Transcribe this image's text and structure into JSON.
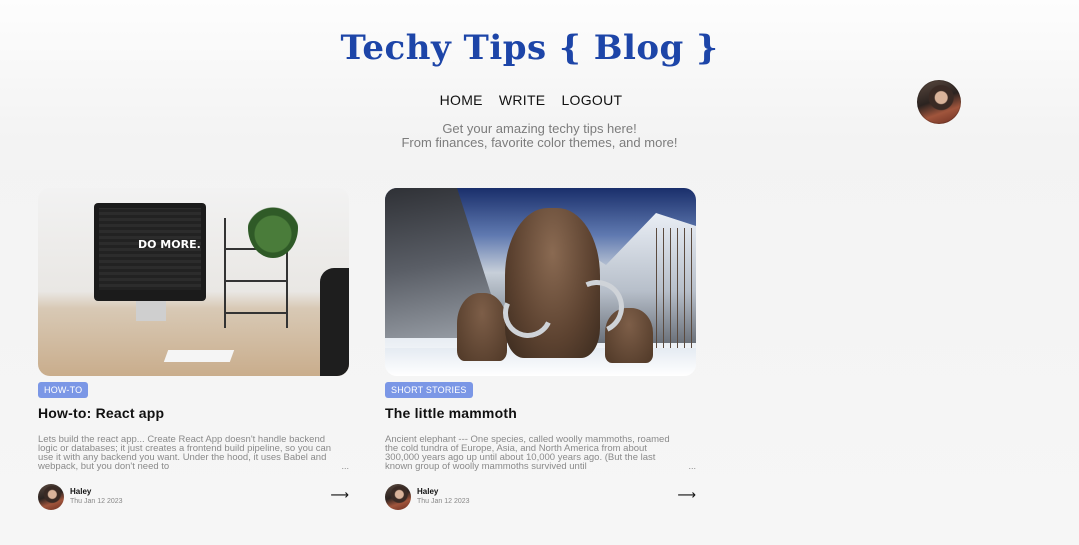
{
  "header": {
    "blog_title": "Techy Tips { Blog }",
    "nav": [
      "HOME",
      "WRITE",
      "LOGOUT"
    ],
    "tagline_line1": "Get your amazing techy tips here!",
    "tagline_line2": "From finances, favorite color themes, and more!"
  },
  "posts": [
    {
      "category": "HOW-TO",
      "title": "How-to: React app",
      "excerpt": "Lets build the react app... Create React App doesn't handle backend logic or databases; it just creates a frontend build pipeline, so you can use it with any backend you want. Under the hood, it uses Babel and webpack, but you don't need to",
      "ellipsis": "...",
      "author": "Haley",
      "date": "Thu Jan 12 2023",
      "monitor_text": "DO MORE."
    },
    {
      "category": "SHORT STORIES",
      "title": "The little mammoth",
      "excerpt": "Ancient elephant --- One species, called woolly mammoths, roamed the cold tundra of Europe, Asia, and North America from about 300,000 years ago up until about 10,000 years ago. (But the last known group of woolly mammoths survived until",
      "ellipsis": "...",
      "author": "Haley",
      "date": "Thu Jan 12 2023"
    }
  ],
  "icons": {
    "read_more": "right-arrow-icon",
    "profile": "user-avatar"
  },
  "colors": {
    "title_blue": "#1d45a8",
    "tag_blue": "#7b97e6",
    "background": "#f6f6f6"
  }
}
